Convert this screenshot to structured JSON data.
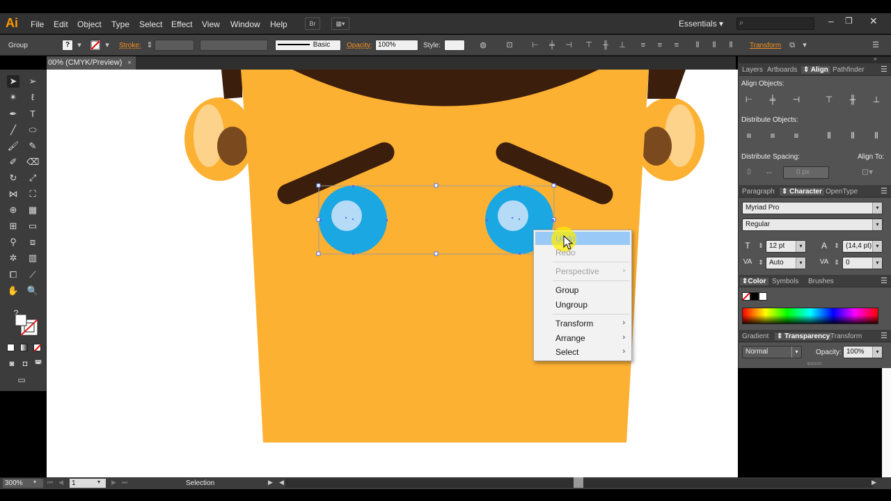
{
  "app": {
    "logo": "Ai",
    "menu": [
      "File",
      "Edit",
      "Object",
      "Type",
      "Select",
      "Effect",
      "View",
      "Window",
      "Help"
    ],
    "bridge_label": "Br",
    "workspace": "Essentials"
  },
  "control_bar": {
    "selection_type": "Group",
    "stroke_label": "Stroke:",
    "brush_label": "Basic",
    "opacity_label": "Opacity:",
    "opacity_value": "100%",
    "style_label": "Style:",
    "transform_label": "Transform"
  },
  "document": {
    "tab_title": "00% (CMYK/Preview)",
    "close_glyph": "×"
  },
  "panels": {
    "top_tabs": [
      "Layers",
      "Artboards",
      "Align",
      "Pathfinder"
    ],
    "align_objects_label": "Align Objects:",
    "distribute_objects_label": "Distribute Objects:",
    "distribute_spacing_label": "Distribute Spacing:",
    "align_to_label": "Align To:",
    "spacing_value": "0 px",
    "char_tabs": [
      "Paragraph",
      "Character",
      "OpenType"
    ],
    "font_family": "Myriad Pro",
    "font_style": "Regular",
    "font_size": "12 pt",
    "leading": "(14,4 pt)",
    "kerning": "Auto",
    "tracking": "0",
    "color_tabs": [
      "Color",
      "Symbols",
      "Brushes"
    ],
    "transparency_tabs": [
      "Gradient",
      "Transparency",
      "Transform"
    ],
    "blend_mode": "Normal",
    "trans_opacity_label": "Opacity:",
    "trans_opacity_value": "100%"
  },
  "status_bar": {
    "zoom": "300%",
    "page": "1",
    "tool": "Selection"
  },
  "context_menu": {
    "items": [
      {
        "label": "Undo",
        "enabled": true,
        "submenu": false
      },
      {
        "label": "Redo",
        "enabled": false,
        "submenu": false
      },
      {
        "label": "Perspective",
        "enabled": false,
        "submenu": true
      },
      {
        "label": "Group",
        "enabled": true,
        "submenu": false
      },
      {
        "label": "Ungroup",
        "enabled": true,
        "submenu": false
      },
      {
        "label": "Transform",
        "enabled": true,
        "submenu": true
      },
      {
        "label": "Arrange",
        "enabled": true,
        "submenu": true
      },
      {
        "label": "Select",
        "enabled": true,
        "submenu": true
      }
    ],
    "submenu_arrow": "›"
  },
  "tools_panel": {
    "type_tool_glyph": "T",
    "unknown_glyph": "?"
  },
  "colors": {
    "face": "#fdb133",
    "hair": "#3b1e0c",
    "ear_inner": "#7a4a1e",
    "ear_highlight": "#fdd28a",
    "eye_outer": "#1aa7e2",
    "eye_inner": "#b5dbf6",
    "selection": "#4b6ff0",
    "accent_orange": "#f7921e"
  }
}
